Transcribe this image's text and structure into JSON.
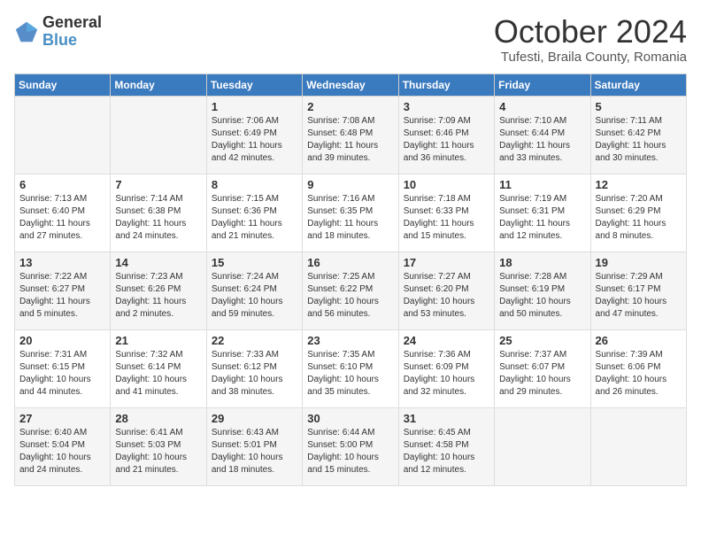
{
  "header": {
    "logo_general": "General",
    "logo_blue": "Blue",
    "month_title": "October 2024",
    "subtitle": "Tufesti, Braila County, Romania"
  },
  "days_of_week": [
    "Sunday",
    "Monday",
    "Tuesday",
    "Wednesday",
    "Thursday",
    "Friday",
    "Saturday"
  ],
  "weeks": [
    [
      {
        "day": "",
        "content": ""
      },
      {
        "day": "",
        "content": ""
      },
      {
        "day": "1",
        "content": "Sunrise: 7:06 AM\nSunset: 6:49 PM\nDaylight: 11 hours and 42 minutes."
      },
      {
        "day": "2",
        "content": "Sunrise: 7:08 AM\nSunset: 6:48 PM\nDaylight: 11 hours and 39 minutes."
      },
      {
        "day": "3",
        "content": "Sunrise: 7:09 AM\nSunset: 6:46 PM\nDaylight: 11 hours and 36 minutes."
      },
      {
        "day": "4",
        "content": "Sunrise: 7:10 AM\nSunset: 6:44 PM\nDaylight: 11 hours and 33 minutes."
      },
      {
        "day": "5",
        "content": "Sunrise: 7:11 AM\nSunset: 6:42 PM\nDaylight: 11 hours and 30 minutes."
      }
    ],
    [
      {
        "day": "6",
        "content": "Sunrise: 7:13 AM\nSunset: 6:40 PM\nDaylight: 11 hours and 27 minutes."
      },
      {
        "day": "7",
        "content": "Sunrise: 7:14 AM\nSunset: 6:38 PM\nDaylight: 11 hours and 24 minutes."
      },
      {
        "day": "8",
        "content": "Sunrise: 7:15 AM\nSunset: 6:36 PM\nDaylight: 11 hours and 21 minutes."
      },
      {
        "day": "9",
        "content": "Sunrise: 7:16 AM\nSunset: 6:35 PM\nDaylight: 11 hours and 18 minutes."
      },
      {
        "day": "10",
        "content": "Sunrise: 7:18 AM\nSunset: 6:33 PM\nDaylight: 11 hours and 15 minutes."
      },
      {
        "day": "11",
        "content": "Sunrise: 7:19 AM\nSunset: 6:31 PM\nDaylight: 11 hours and 12 minutes."
      },
      {
        "day": "12",
        "content": "Sunrise: 7:20 AM\nSunset: 6:29 PM\nDaylight: 11 hours and 8 minutes."
      }
    ],
    [
      {
        "day": "13",
        "content": "Sunrise: 7:22 AM\nSunset: 6:27 PM\nDaylight: 11 hours and 5 minutes."
      },
      {
        "day": "14",
        "content": "Sunrise: 7:23 AM\nSunset: 6:26 PM\nDaylight: 11 hours and 2 minutes."
      },
      {
        "day": "15",
        "content": "Sunrise: 7:24 AM\nSunset: 6:24 PM\nDaylight: 10 hours and 59 minutes."
      },
      {
        "day": "16",
        "content": "Sunrise: 7:25 AM\nSunset: 6:22 PM\nDaylight: 10 hours and 56 minutes."
      },
      {
        "day": "17",
        "content": "Sunrise: 7:27 AM\nSunset: 6:20 PM\nDaylight: 10 hours and 53 minutes."
      },
      {
        "day": "18",
        "content": "Sunrise: 7:28 AM\nSunset: 6:19 PM\nDaylight: 10 hours and 50 minutes."
      },
      {
        "day": "19",
        "content": "Sunrise: 7:29 AM\nSunset: 6:17 PM\nDaylight: 10 hours and 47 minutes."
      }
    ],
    [
      {
        "day": "20",
        "content": "Sunrise: 7:31 AM\nSunset: 6:15 PM\nDaylight: 10 hours and 44 minutes."
      },
      {
        "day": "21",
        "content": "Sunrise: 7:32 AM\nSunset: 6:14 PM\nDaylight: 10 hours and 41 minutes."
      },
      {
        "day": "22",
        "content": "Sunrise: 7:33 AM\nSunset: 6:12 PM\nDaylight: 10 hours and 38 minutes."
      },
      {
        "day": "23",
        "content": "Sunrise: 7:35 AM\nSunset: 6:10 PM\nDaylight: 10 hours and 35 minutes."
      },
      {
        "day": "24",
        "content": "Sunrise: 7:36 AM\nSunset: 6:09 PM\nDaylight: 10 hours and 32 minutes."
      },
      {
        "day": "25",
        "content": "Sunrise: 7:37 AM\nSunset: 6:07 PM\nDaylight: 10 hours and 29 minutes."
      },
      {
        "day": "26",
        "content": "Sunrise: 7:39 AM\nSunset: 6:06 PM\nDaylight: 10 hours and 26 minutes."
      }
    ],
    [
      {
        "day": "27",
        "content": "Sunrise: 6:40 AM\nSunset: 5:04 PM\nDaylight: 10 hours and 24 minutes."
      },
      {
        "day": "28",
        "content": "Sunrise: 6:41 AM\nSunset: 5:03 PM\nDaylight: 10 hours and 21 minutes."
      },
      {
        "day": "29",
        "content": "Sunrise: 6:43 AM\nSunset: 5:01 PM\nDaylight: 10 hours and 18 minutes."
      },
      {
        "day": "30",
        "content": "Sunrise: 6:44 AM\nSunset: 5:00 PM\nDaylight: 10 hours and 15 minutes."
      },
      {
        "day": "31",
        "content": "Sunrise: 6:45 AM\nSunset: 4:58 PM\nDaylight: 10 hours and 12 minutes."
      },
      {
        "day": "",
        "content": ""
      },
      {
        "day": "",
        "content": ""
      }
    ]
  ]
}
